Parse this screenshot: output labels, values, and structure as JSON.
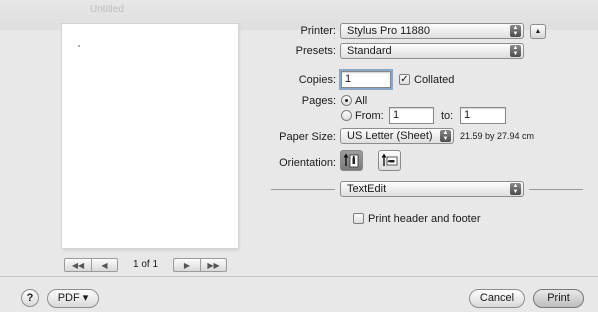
{
  "background_window": {
    "title": "Untitled"
  },
  "preview": {
    "page_indicator": "1 of 1"
  },
  "printer": {
    "label": "Printer:",
    "value": "Stylus Pro 11880"
  },
  "presets": {
    "label": "Presets:",
    "value": "Standard"
  },
  "copies": {
    "label": "Copies:",
    "value": "1",
    "collated_label": "Collated",
    "collated_checked": true
  },
  "pages": {
    "label": "Pages:",
    "all_label": "All",
    "from_label": "From:",
    "from_value": "1",
    "to_label": "to:",
    "to_value": "1",
    "selected": "All"
  },
  "paper_size": {
    "label": "Paper Size:",
    "value": "US Letter (Sheet)",
    "dimensions": "21.59 by 27.94 cm"
  },
  "orientation": {
    "label": "Orientation:",
    "selected": "portrait"
  },
  "section": {
    "value": "TextEdit"
  },
  "print_header_footer": {
    "label": "Print header and footer",
    "checked": false
  },
  "footer": {
    "help": "?",
    "pdf_label": "PDF ▾",
    "cancel_label": "Cancel",
    "print_label": "Print"
  },
  "colors": {
    "dialog_bg": "#e8e8e8",
    "focus_ring": "#8aa6c9"
  }
}
